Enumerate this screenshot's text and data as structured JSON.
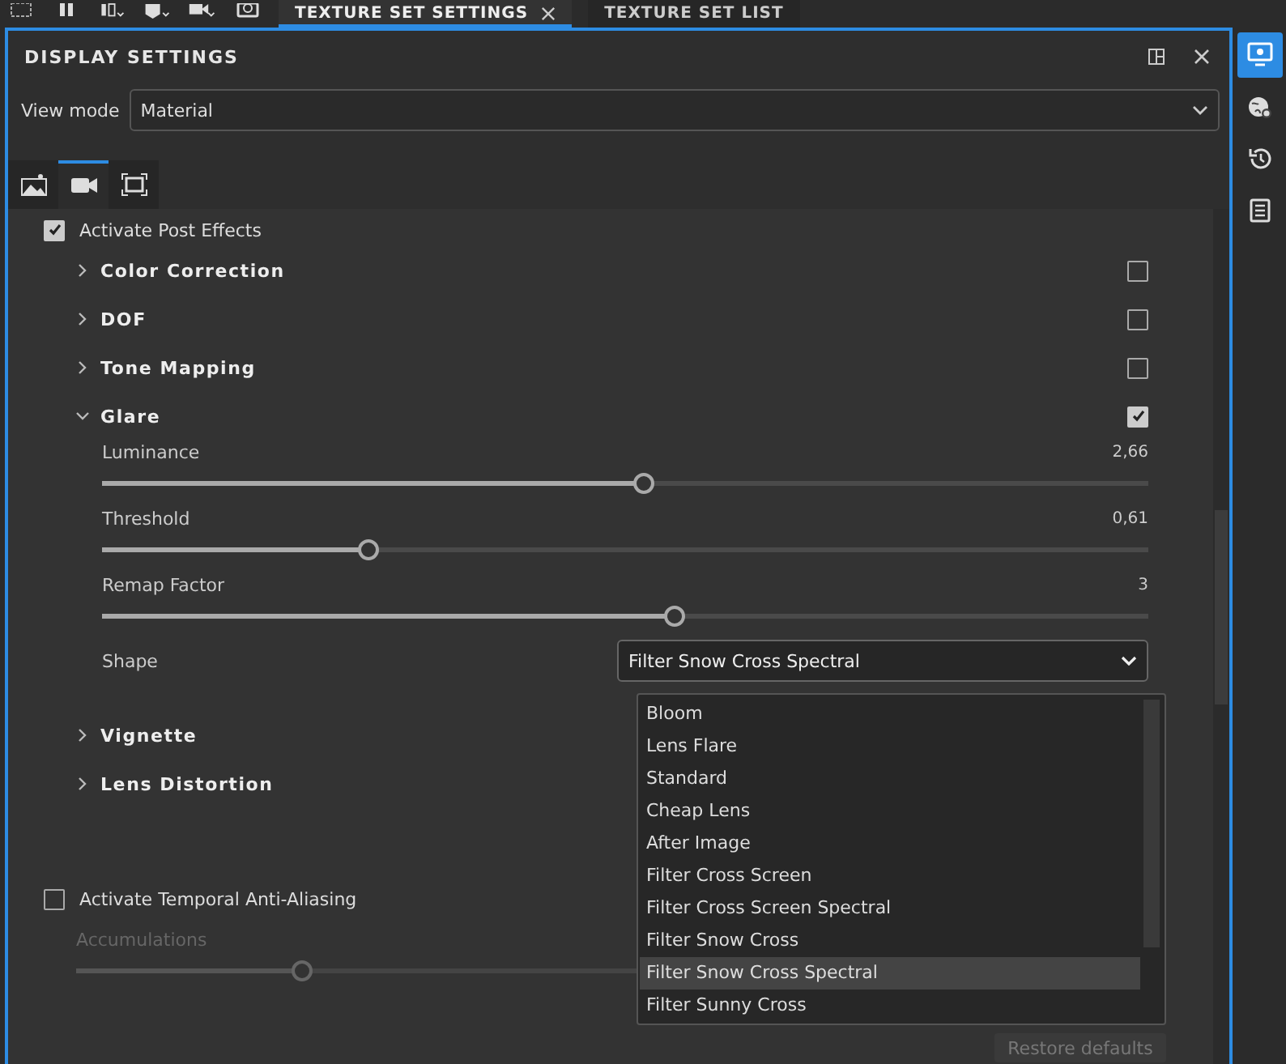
{
  "top_tabs": [
    {
      "label": "TEXTURE SET SETTINGS",
      "selected": true,
      "closable": true
    },
    {
      "label": "TEXTURE SET LIST",
      "selected": false
    }
  ],
  "panel": {
    "title": "DISPLAY SETTINGS"
  },
  "view_mode": {
    "label": "View mode",
    "value": "Material"
  },
  "mode_tabs": [
    {
      "kind": "image",
      "selected": false
    },
    {
      "kind": "camera",
      "selected": true
    },
    {
      "kind": "frame",
      "selected": false
    }
  ],
  "post_effects": {
    "label": "Activate Post Effects",
    "checked": true
  },
  "sections": [
    {
      "title": "Color Correction",
      "expanded": false,
      "checked": false
    },
    {
      "title": "DOF",
      "expanded": false,
      "checked": false
    },
    {
      "title": "Tone Mapping",
      "expanded": false,
      "checked": false
    },
    {
      "title": "Glare",
      "expanded": true,
      "checked": true,
      "sliders": [
        {
          "label": "Luminance",
          "reading": "2,66",
          "level": 0.517
        },
        {
          "label": "Threshold",
          "reading": "0,61",
          "level": 0.254
        },
        {
          "label": "Remap Factor",
          "reading": "3",
          "level": 0.547
        }
      ],
      "shape": {
        "label": "Shape",
        "value": "Filter Snow Cross Spectral"
      }
    },
    {
      "title": "Vignette",
      "expanded": false
    },
    {
      "title": "Lens Distortion",
      "expanded": false
    }
  ],
  "taa": {
    "label": "Activate Temporal Anti-Aliasing",
    "checked": false,
    "accumulations": {
      "label": "Accumulations",
      "level": 0.21,
      "disabled": true
    }
  },
  "shape_options": [
    {
      "label": "Bloom",
      "selected": false
    },
    {
      "label": "Lens Flare",
      "selected": false
    },
    {
      "label": "Standard",
      "selected": false
    },
    {
      "label": "Cheap Lens",
      "selected": false
    },
    {
      "label": "After Image",
      "selected": false
    },
    {
      "label": "Filter Cross Screen",
      "selected": false
    },
    {
      "label": "Filter Cross Screen Spectral",
      "selected": false
    },
    {
      "label": "Filter Snow Cross",
      "selected": false
    },
    {
      "label": "Filter Snow Cross Spectral",
      "selected": true
    },
    {
      "label": "Filter Sunny Cross",
      "selected": false
    }
  ],
  "restore_button": {
    "label": "Restore defaults"
  },
  "side_tabs": [
    {
      "kind": "display",
      "selected": true
    },
    {
      "kind": "globe",
      "selected": false
    },
    {
      "kind": "history",
      "selected": false
    },
    {
      "kind": "clipboard",
      "selected": false
    }
  ]
}
